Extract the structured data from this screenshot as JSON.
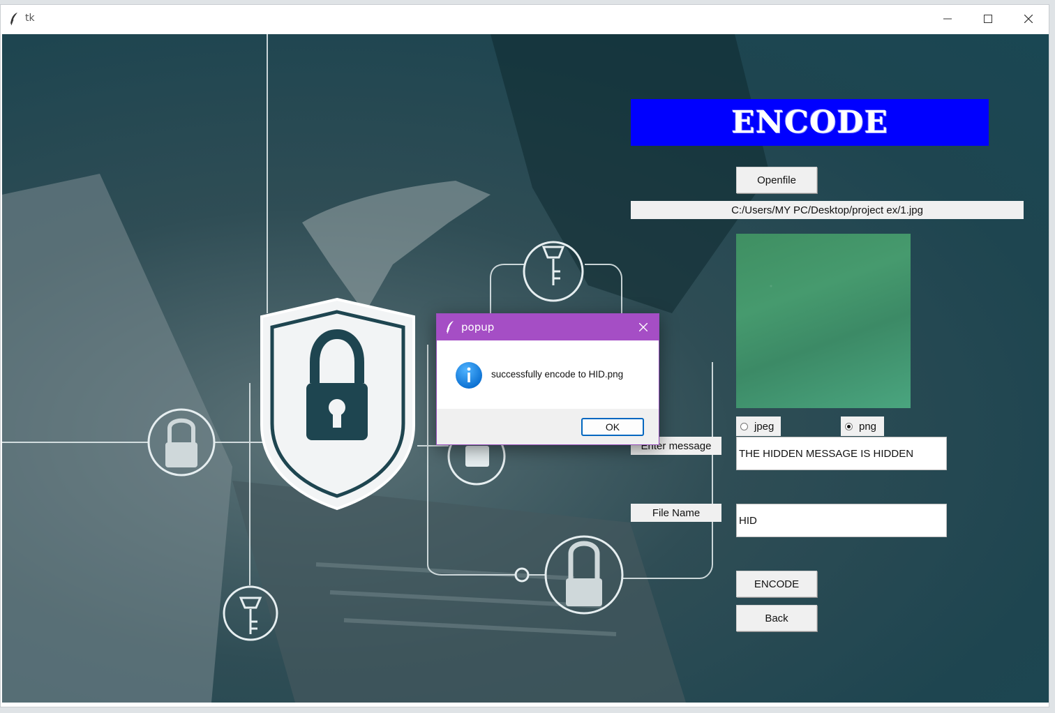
{
  "window": {
    "title": "tk",
    "icon": "feather-icon",
    "controls": [
      "minimize-icon",
      "maximize-icon",
      "close-icon"
    ]
  },
  "app": {
    "header": "ENCODE",
    "openfile_label": "Openfile",
    "file_path": "C:/Users/MY PC/Desktop/project ex/1.jpg",
    "format": {
      "options": [
        {
          "label": "jpeg",
          "selected": false
        },
        {
          "label": "png",
          "selected": true
        }
      ]
    },
    "message_label": "Enter message",
    "message_value": "THE HIDDEN MESSAGE IS HIDDEN",
    "filename_label": "File Name",
    "filename_value": "HID",
    "encode_button": "ENCODE",
    "back_button": "Back"
  },
  "popup": {
    "title": "popup",
    "icon": "info-icon",
    "message": "successfully encode to HID.png",
    "ok_label": "OK"
  },
  "colors": {
    "banner": "#0000ff",
    "popup_titlebar": "#a54ec5",
    "ok_border": "#0067c0"
  }
}
